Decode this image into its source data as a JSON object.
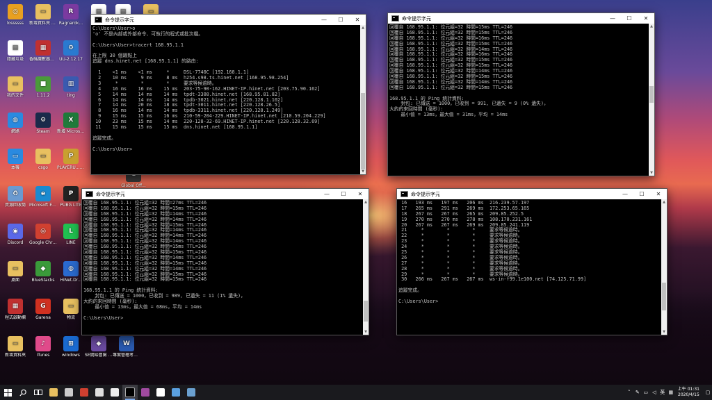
{
  "desktop": {
    "icons": [
      {
        "label": "lossssss",
        "color": "#e8a020",
        "glyph": "◎"
      },
      {
        "label": "新增資料夾 (2)",
        "color": "#e8c060",
        "glyph": "▭"
      },
      {
        "label": "Ragnarok...",
        "color": "#7a3aa0",
        "glyph": "R"
      },
      {
        "label": "",
        "color": "#ffffff",
        "glyph": "▤"
      },
      {
        "label": "",
        "color": "#ffffff",
        "glyph": "▤"
      },
      {
        "label": "",
        "color": "#e8c060",
        "glyph": "▭"
      },
      {
        "label": "隱藏垃圾",
        "color": "#ffffff",
        "glyph": "▤"
      },
      {
        "label": "香碼魔數器RGB",
        "color": "#c03030",
        "glyph": "▦"
      },
      {
        "label": "UU-2.12.17",
        "color": "#2a7ad0",
        "glyph": "⚙"
      },
      {
        "label": "我的文件",
        "color": "#e8c060",
        "glyph": "▭"
      },
      {
        "label": "1.11.2",
        "color": "#4a9a3a",
        "glyph": "■"
      },
      {
        "label": "ting",
        "color": "#3a5ab0",
        "glyph": "▥"
      },
      {
        "label": "網路",
        "color": "#2a8ae0",
        "glyph": "◍"
      },
      {
        "label": "Steam",
        "color": "#1a2a4a",
        "glyph": "⚙"
      },
      {
        "label": "新增 Microsoft...",
        "color": "#1f7a3a",
        "glyph": "X"
      },
      {
        "label": "本機",
        "color": "#2a8ae0",
        "glyph": "▭"
      },
      {
        "label": "csgo",
        "color": "#e8c060",
        "glyph": "▭"
      },
      {
        "label": "PLAYERU... BATTLEGR...",
        "color": "#c8a030",
        "glyph": "P"
      },
      {
        "label": "Global Off...",
        "color": "#3a3a3a",
        "glyph": "G"
      },
      {
        "label": "資源回收筒",
        "color": "#6a9ad0",
        "glyph": "♻"
      },
      {
        "label": "Microsoft Edge",
        "color": "#1a8ad0",
        "glyph": "e"
      },
      {
        "label": "PUBG LITE",
        "color": "#222222",
        "glyph": "P"
      },
      {
        "label": "Discord",
        "color": "#5a68e8",
        "glyph": "◉"
      },
      {
        "label": "Google Chrome",
        "color": "#d04030",
        "glyph": "◎"
      },
      {
        "label": "LINE",
        "color": "#20c050",
        "glyph": "L"
      },
      {
        "label": "桌面",
        "color": "#e8c060",
        "glyph": "▭"
      },
      {
        "label": "BlueStacks",
        "color": "#3a9a3a",
        "glyph": "◆"
      },
      {
        "label": "HiNet.Dr...",
        "color": "#2a6ad0",
        "glyph": "◍"
      },
      {
        "label": "程式啟動欄",
        "color": "#c03030",
        "glyph": "▦"
      },
      {
        "label": "Garena",
        "color": "#d03020",
        "glyph": "G"
      },
      {
        "label": "物流",
        "color": "#e8c060",
        "glyph": "▭"
      },
      {
        "label": "新增資料夾",
        "color": "#e8c060",
        "glyph": "▭"
      },
      {
        "label": "iTunes",
        "color": "#e04a8a",
        "glyph": "♪"
      },
      {
        "label": "windows",
        "color": "#1a6ad0",
        "glyph": "⊞"
      },
      {
        "label": "SE開始冒險 2.0",
        "color": "#6a4aa0",
        "glyph": "◆"
      },
      {
        "label": "專案管理考試 題庫2",
        "color": "#2a5ab0",
        "glyph": "W"
      }
    ]
  },
  "windows": [
    {
      "title": "命令提示字元",
      "lines": [
        "C:\\Users\\User>o",
        "'o' 不是內部或外部命令、可執行的程式或批次檔。",
        "",
        "C:\\Users\\User>tracert 168.95.1.1",
        "",
        "在上限 30 個躍點上",
        "追蹤 dns.hinet.net [168.95.1.1] 的路由:",
        "",
        "  1    <1 ms    <1 ms     *     DSL-7740C [192.168.1.1]",
        "  2    10 ms     9 ms     8 ms  h254.s98.ts.hinet.net [168.95.98.254]",
        "  3     *        *        *     要求等候逾時。",
        "  4    16 ms    16 ms    15 ms  203-75-90-162.HINET-IP.hinet.net [203.75.90.162]",
        "  5    14 ms    14 ms    14 ms  tpdt-3308.hinet.net [168.95.81.82]",
        "  6    14 ms    14 ms    14 ms  tpdb-3021.hinet.net [220.128.1.102]",
        "  7    14 ms    20 ms    18 ms  tpdt-3011.hinet.net [220.128.26.5]",
        "  8    16 ms    14 ms    14 ms  tpdb-3311.hinet.net [220.128.1.249]",
        "  9    15 ms    15 ms    16 ms  210-59-204-229.HINET-IP.hinet.net [210.59.204.229]",
        " 10    23 ms    15 ms    14 ms  220-128-32-69.HINET-IP.hinet.net [220.128.32.69]",
        " 11    15 ms    15 ms    15 ms  dns.hinet.net [168.95.1.1]",
        "",
        "追蹤完成。",
        "",
        "C:\\Users\\User>"
      ]
    },
    {
      "title": "命令提示字元",
      "lines": [
        "回覆自 168.95.1.1: 位元組=32 時間=15ms TTL=246",
        "回覆自 168.95.1.1: 位元組=32 時間=15ms TTL=246",
        "回覆自 168.95.1.1: 位元組=32 時間=16ms TTL=246",
        "回覆自 168.95.1.1: 位元組=32 時間=15ms TTL=246",
        "回覆自 168.95.1.1: 位元組=32 時間=14ms TTL=246",
        "回覆自 168.95.1.1: 位元組=32 時間=16ms TTL=246",
        "回覆自 168.95.1.1: 位元組=32 時間=15ms TTL=246",
        "回覆自 168.95.1.1: 位元組=32 時間=15ms TTL=246",
        "回覆自 168.95.1.1: 位元組=32 時間=14ms TTL=246",
        "回覆自 168.95.1.1: 位元組=32 時間=15ms TTL=246",
        "回覆自 168.95.1.1: 位元組=32 時間=14ms TTL=246",
        "回覆自 168.95.1.1: 位元組=32 時間=15ms TTL=246",
        "",
        "168.95.1.1 的 Ping 統計資料:",
        "    封包: 已傳送 = 1000，已收到 = 991, 已遺失 = 9 (0% 遺失)，",
        "大約的來回時間 (毫秒):",
        "    最小值 = 13ms，最大值 = 31ms，平均 = 14ms"
      ]
    },
    {
      "title": "命令提示字元",
      "lines": [
        "回覆自 168.95.1.1: 位元組=32 時間=27ms TTL=246",
        "回覆自 168.95.1.1: 位元組=32 時間=15ms TTL=246",
        "回覆自 168.95.1.1: 位元組=32 時間=14ms TTL=246",
        "回覆自 168.95.1.1: 位元組=32 時間=14ms TTL=246",
        "回覆自 168.95.1.1: 位元組=32 時間=15ms TTL=246",
        "回覆自 168.95.1.1: 位元組=32 時間=14ms TTL=246",
        "回覆自 168.95.1.1: 位元組=32 時間=14ms TTL=246",
        "回覆自 168.95.1.1: 位元組=32 時間=14ms TTL=246",
        "回覆自 168.95.1.1: 位元組=32 時間=15ms TTL=246",
        "回覆自 168.95.1.1: 位元組=32 時間=15ms TTL=246",
        "回覆自 168.95.1.1: 位元組=32 時間=14ms TTL=246",
        "回覆自 168.95.1.1: 位元組=32 時間=15ms TTL=246",
        "回覆自 168.95.1.1: 位元組=32 時間=14ms TTL=246",
        "回覆自 168.95.1.1: 位元組=32 時間=15ms TTL=246",
        "回覆自 168.95.1.1: 位元組=32 時間=15ms TTL=246",
        "",
        "168.95.1.1 的 Ping 統計資料:",
        "    封包: 已傳送 = 1000，已收到 = 989, 已遺失 = 11 (1% 遺失)，",
        "大約的來回時間 (毫秒):",
        "    最小值 = 13ms，最大值 = 68ms，平均 = 14ms",
        "",
        "C:\\Users\\User>"
      ]
    },
    {
      "title": "命令提示字元",
      "lines": [
        " 16   193 ms   197 ms   206 ms  216.239.57.197",
        " 17   265 ms   291 ms   269 ms  172.253.65.165",
        " 18   267 ms   267 ms   265 ms  209.85.252.5",
        " 19   270 ms   270 ms   278 ms  108.170.231.161",
        " 20   267 ms   267 ms   269 ms  209.85.241.119",
        " 21     *        *        *     要求等候逾時。",
        " 22     *        *        *     要求等候逾時。",
        " 23     *        *        *     要求等候逾時。",
        " 24     *        *        *     要求等候逾時。",
        " 25     *        *        *     要求等候逾時。",
        " 26     *        *        *     要求等候逾時。",
        " 27     *        *        *     要求等候逾時。",
        " 28     *        *        *     要求等候逾時。",
        " 29     *        *        *     要求等候逾時。",
        " 30   266 ms   267 ms   267 ms  ws-in-f99.1e100.net [74.125.71.99]",
        "",
        "追蹤完成。",
        "",
        "C:\\Users\\User>"
      ]
    }
  ],
  "taskbar": {
    "apps": [
      {
        "name": "file-explorer",
        "color": "#e8c060"
      },
      {
        "name": "wechat",
        "color": "#cccccc"
      },
      {
        "name": "chrome",
        "color": "#d04030"
      },
      {
        "name": "store",
        "color": "#dddddd"
      },
      {
        "name": "shield",
        "color": "#eeeeee"
      },
      {
        "name": "cmd",
        "color": "#000000"
      },
      {
        "name": "app-rgb",
        "color": "#a04aa0"
      },
      {
        "name": "settings",
        "color": "#ffffff"
      },
      {
        "name": "mail",
        "color": "#5aa0e0"
      },
      {
        "name": "app-blue",
        "color": "#6aa0d0"
      }
    ],
    "time": "上午 01:31",
    "date": "2020/4/15",
    "lang": "英"
  }
}
